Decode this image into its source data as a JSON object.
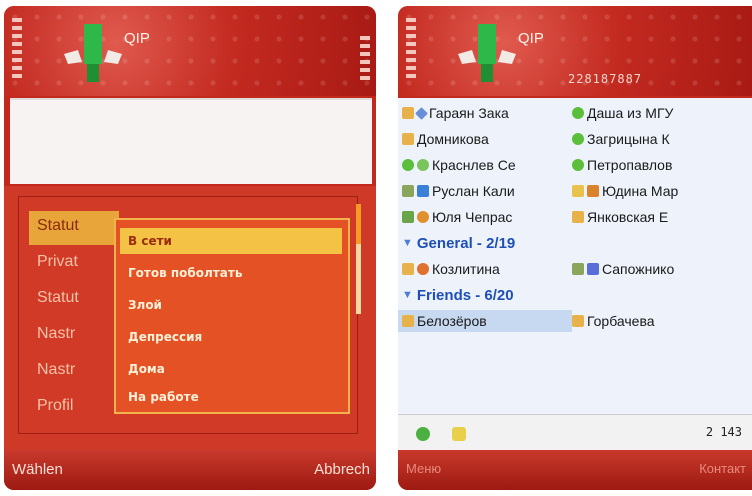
{
  "left_screen": {
    "app_title": "QIP",
    "menu": {
      "items": [
        "Statut",
        "Privat",
        "Statut",
        "Nastr",
        "Nastr",
        "Profil"
      ],
      "selected_index": 0
    },
    "submenu": {
      "items": [
        "В сети",
        "Готов поболтать",
        "Злой",
        "Депрессия",
        "Дома",
        "На работе"
      ],
      "selected_index": 0
    },
    "softkeys": {
      "left": "Wählen",
      "right": "Abbrech"
    }
  },
  "right_screen": {
    "app_title": "QIP",
    "uin": "228187887",
    "rows": [
      {
        "type": "pair",
        "left": "Гараян Зака",
        "right": "Даша из МГУ"
      },
      {
        "type": "pair",
        "left": "Домникова",
        "right": "Загрицына К"
      },
      {
        "type": "pair",
        "left": "Краснлев Се",
        "right": "Петропавлов"
      },
      {
        "type": "pair",
        "left": "Руслан Кали",
        "right": "Юдина Мар"
      },
      {
        "type": "pair",
        "left": "Юля Чепрас",
        "right": "Янковская Е"
      },
      {
        "type": "group",
        "label": "General - 2/19"
      },
      {
        "type": "pair",
        "left": "Козлитина",
        "right": "Сапожнико"
      },
      {
        "type": "group",
        "label": "Friends - 6/20"
      },
      {
        "type": "pair",
        "left": "Белозёров",
        "right": "Горбачева",
        "left_selected": true
      }
    ],
    "status_count": "2 143",
    "softkeys": {
      "left": "Меню",
      "right": "Контакт"
    }
  },
  "colors": {
    "header_red": "#c32a20",
    "selection_orange": "#f4c244",
    "group_blue": "#1e4fb8",
    "list_bg": "#eef3fb"
  }
}
